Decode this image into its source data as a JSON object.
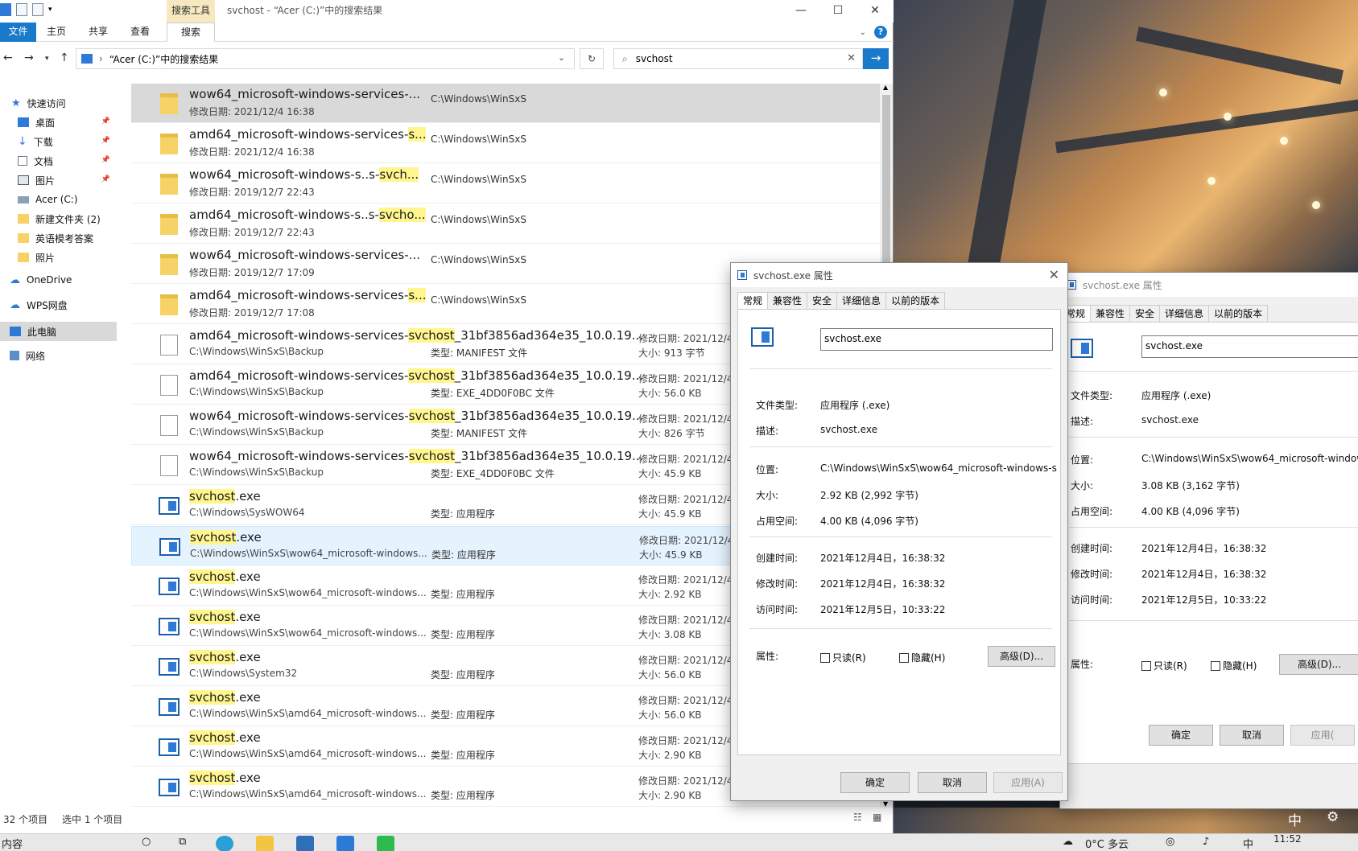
{
  "explorer": {
    "window_title": "svchost - “Acer (C:)”中的搜索结果",
    "context_tab": "搜索工具",
    "win_buttons": {
      "minimize": "—",
      "maximize": "☐",
      "close": "✕"
    },
    "ribbon_tabs": [
      "文件",
      "主页",
      "共享",
      "查看",
      "搜索"
    ],
    "address": "“Acer (C:)”中的搜索结果",
    "search_value": "svchost",
    "nav": {
      "quick_access": "快速访问",
      "items": [
        "桌面",
        "下载",
        "文档",
        "图片",
        "Acer (C:)",
        "新建文件夹 (2)",
        "英语模考答案",
        "照片"
      ],
      "onedrive": "OneDrive",
      "wps": "WPS网盘",
      "this_pc": "此电脑",
      "network": "网络"
    },
    "rows": [
      {
        "pre": "wow64_microsoft-windows-services-...",
        "hl": "",
        "post": "",
        "sub": "修改日期: 2021/12/4 16:38",
        "loc": "C:\\Windows\\WinSxS",
        "type": "",
        "date": "",
        "size": "",
        "icon": "folder"
      },
      {
        "pre": "amd64_microsoft-windows-services-",
        "hl": "s...",
        "post": "",
        "sub": "修改日期: 2021/12/4 16:38",
        "loc": "C:\\Windows\\WinSxS",
        "type": "",
        "date": "",
        "size": "",
        "icon": "folder"
      },
      {
        "pre": "wow64_microsoft-windows-s..s-",
        "hl": "svch...",
        "post": "",
        "sub": "修改日期: 2019/12/7 22:43",
        "loc": "C:\\Windows\\WinSxS",
        "type": "",
        "date": "",
        "size": "",
        "icon": "folder"
      },
      {
        "pre": "amd64_microsoft-windows-s..s-",
        "hl": "svcho...",
        "post": "",
        "sub": "修改日期: 2019/12/7 22:43",
        "loc": "C:\\Windows\\WinSxS",
        "type": "",
        "date": "",
        "size": "",
        "icon": "folder"
      },
      {
        "pre": "wow64_microsoft-windows-services-...",
        "hl": "",
        "post": "",
        "sub": "修改日期: 2019/12/7 17:09",
        "loc": "C:\\Windows\\WinSxS",
        "type": "",
        "date": "",
        "size": "",
        "icon": "folder"
      },
      {
        "pre": "amd64_microsoft-windows-services-",
        "hl": "s...",
        "post": "",
        "sub": "修改日期: 2019/12/7 17:08",
        "loc": "C:\\Windows\\WinSxS",
        "type": "",
        "date": "",
        "size": "",
        "icon": "folder"
      },
      {
        "pre": "amd64_microsoft-windows-services-",
        "hl": "svchost",
        "post": "_31bf3856ad364e35_10.0.19...",
        "sub": "C:\\Windows\\WinSxS\\Backup",
        "loc": "",
        "type": "类型: MANIFEST 文件",
        "date": "修改日期: 2021/12/4",
        "size": "大小: 913 字节",
        "icon": "doc"
      },
      {
        "pre": "amd64_microsoft-windows-services-",
        "hl": "svchost",
        "post": "_31bf3856ad364e35_10.0.19...",
        "sub": "C:\\Windows\\WinSxS\\Backup",
        "loc": "",
        "type": "类型: EXE_4DD0F0BC 文件",
        "date": "修改日期: 2021/12/4",
        "size": "大小: 56.0 KB",
        "icon": "doc"
      },
      {
        "pre": "wow64_microsoft-windows-services-",
        "hl": "svchost",
        "post": "_31bf3856ad364e35_10.0.19...",
        "sub": "C:\\Windows\\WinSxS\\Backup",
        "loc": "",
        "type": "类型: MANIFEST 文件",
        "date": "修改日期: 2021/12/4",
        "size": "大小: 826 字节",
        "icon": "doc"
      },
      {
        "pre": "wow64_microsoft-windows-services-",
        "hl": "svchost",
        "post": "_31bf3856ad364e35_10.0.19...",
        "sub": "C:\\Windows\\WinSxS\\Backup",
        "loc": "",
        "type": "类型: EXE_4DD0F0BC 文件",
        "date": "修改日期: 2021/12/4",
        "size": "大小: 45.9 KB",
        "icon": "doc"
      },
      {
        "pre": "",
        "hl": "svchost",
        "post": ".exe",
        "sub": "C:\\Windows\\SysWOW64",
        "loc": "",
        "type": "类型: 应用程序",
        "date": "修改日期: 2021/12/4",
        "size": "大小: 45.9 KB",
        "icon": "exe"
      },
      {
        "pre": "",
        "hl": "svchost",
        "post": ".exe",
        "sub": "C:\\Windows\\WinSxS\\wow64_microsoft-windows...",
        "loc": "",
        "type": "类型: 应用程序",
        "date": "修改日期: 2021/12/4",
        "size": "大小: 45.9 KB",
        "icon": "exe"
      },
      {
        "pre": "",
        "hl": "svchost",
        "post": ".exe",
        "sub": "C:\\Windows\\WinSxS\\wow64_microsoft-windows...",
        "loc": "",
        "type": "类型: 应用程序",
        "date": "修改日期: 2021/12/4",
        "size": "大小: 2.92 KB",
        "icon": "exe"
      },
      {
        "pre": "",
        "hl": "svchost",
        "post": ".exe",
        "sub": "C:\\Windows\\WinSxS\\wow64_microsoft-windows...",
        "loc": "",
        "type": "类型: 应用程序",
        "date": "修改日期: 2021/12/4",
        "size": "大小: 3.08 KB",
        "icon": "exe"
      },
      {
        "pre": "",
        "hl": "svchost",
        "post": ".exe",
        "sub": "C:\\Windows\\System32",
        "loc": "",
        "type": "类型: 应用程序",
        "date": "修改日期: 2021/12/4",
        "size": "大小: 56.0 KB",
        "icon": "exe"
      },
      {
        "pre": "",
        "hl": "svchost",
        "post": ".exe",
        "sub": "C:\\Windows\\WinSxS\\amd64_microsoft-windows...",
        "loc": "",
        "type": "类型: 应用程序",
        "date": "修改日期: 2021/12/4",
        "size": "大小: 56.0 KB",
        "icon": "exe"
      },
      {
        "pre": "",
        "hl": "svchost",
        "post": ".exe",
        "sub": "C:\\Windows\\WinSxS\\amd64_microsoft-windows...",
        "loc": "",
        "type": "类型: 应用程序",
        "date": "修改日期: 2021/12/4",
        "size": "大小: 2.90 KB",
        "icon": "exe"
      },
      {
        "pre": "",
        "hl": "svchost",
        "post": ".exe",
        "sub": "C:\\Windows\\WinSxS\\amd64_microsoft-windows...",
        "loc": "",
        "type": "类型: 应用程序",
        "date": "修改日期: 2021/12/4",
        "size": "大小: 2.90 KB",
        "icon": "exe"
      }
    ],
    "status_count": "32 个项目",
    "status_selected": "选中 1 个项目"
  },
  "dialog1": {
    "title": "svchost.exe 属性",
    "tabs": [
      "常规",
      "兼容性",
      "安全",
      "详细信息",
      "以前的版本"
    ],
    "filename": "svchost.exe",
    "fields": [
      {
        "label": "文件类型:",
        "value": "应用程序 (.exe)"
      },
      {
        "label": "描述:",
        "value": "svchost.exe"
      },
      {
        "label": "位置:",
        "value": "C:\\Windows\\WinSxS\\wow64_microsoft-windows-s"
      },
      {
        "label": "大小:",
        "value": "2.92 KB (2,992 字节)"
      },
      {
        "label": "占用空间:",
        "value": "4.00 KB (4,096 字节)"
      },
      {
        "label": "创建时间:",
        "value": "2021年12月4日，16:38:32"
      },
      {
        "label": "修改时间:",
        "value": "2021年12月4日，16:38:32"
      },
      {
        "label": "访问时间:",
        "value": "2021年12月5日，10:33:22"
      }
    ],
    "attr_label": "属性:",
    "readonly": "只读(R)",
    "hidden": "隐藏(H)",
    "advanced": "高级(D)...",
    "ok": "确定",
    "cancel": "取消",
    "apply": "应用(A)"
  },
  "dialog2": {
    "title": "svchost.exe 属性",
    "tabs": [
      "常规",
      "兼容性",
      "安全",
      "详细信息",
      "以前的版本"
    ],
    "filename": "svchost.exe",
    "fields": [
      {
        "label": "文件类型:",
        "value": "应用程序 (.exe)"
      },
      {
        "label": "描述:",
        "value": "svchost.exe"
      },
      {
        "label": "位置:",
        "value": "C:\\Windows\\WinSxS\\wow64_microsoft-window"
      },
      {
        "label": "大小:",
        "value": "3.08 KB (3,162 字节)"
      },
      {
        "label": "占用空间:",
        "value": "4.00 KB (4,096 字节)"
      },
      {
        "label": "创建时间:",
        "value": "2021年12月4日，16:38:32"
      },
      {
        "label": "修改时间:",
        "value": "2021年12月4日，16:38:32"
      },
      {
        "label": "访问时间:",
        "value": "2021年12月5日，10:33:22"
      }
    ],
    "attr_label": "属性:",
    "readonly": "只读(R)",
    "hidden": "隐藏(H)",
    "advanced": "高级(D)...",
    "ok": "确定",
    "cancel": "取消",
    "apply": "应用("
  },
  "taskbar": {
    "left_text": "内容",
    "ime": "中",
    "weather": "0°C 多云",
    "lang": "中",
    "time": "11:52"
  }
}
